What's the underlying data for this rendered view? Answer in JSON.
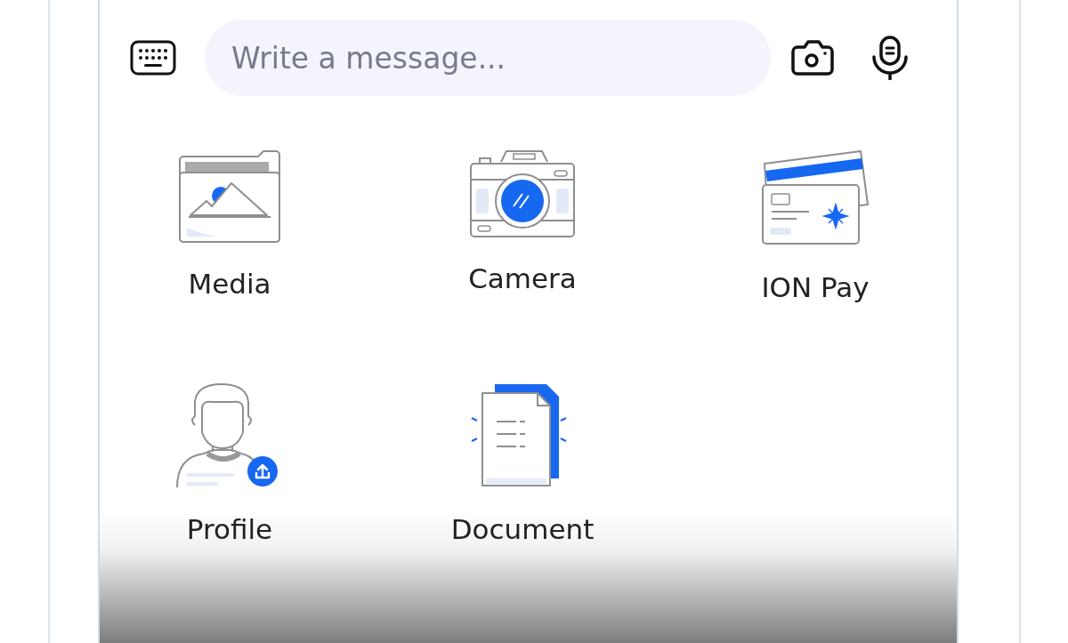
{
  "composer": {
    "placeholder": "Write a message..."
  },
  "attachments": [
    {
      "kind": "media",
      "label": "Media"
    },
    {
      "kind": "camera",
      "label": "Camera"
    },
    {
      "kind": "pay",
      "label": "ION Pay"
    },
    {
      "kind": "profile",
      "label": "Profile"
    },
    {
      "kind": "document",
      "label": "Document"
    }
  ]
}
